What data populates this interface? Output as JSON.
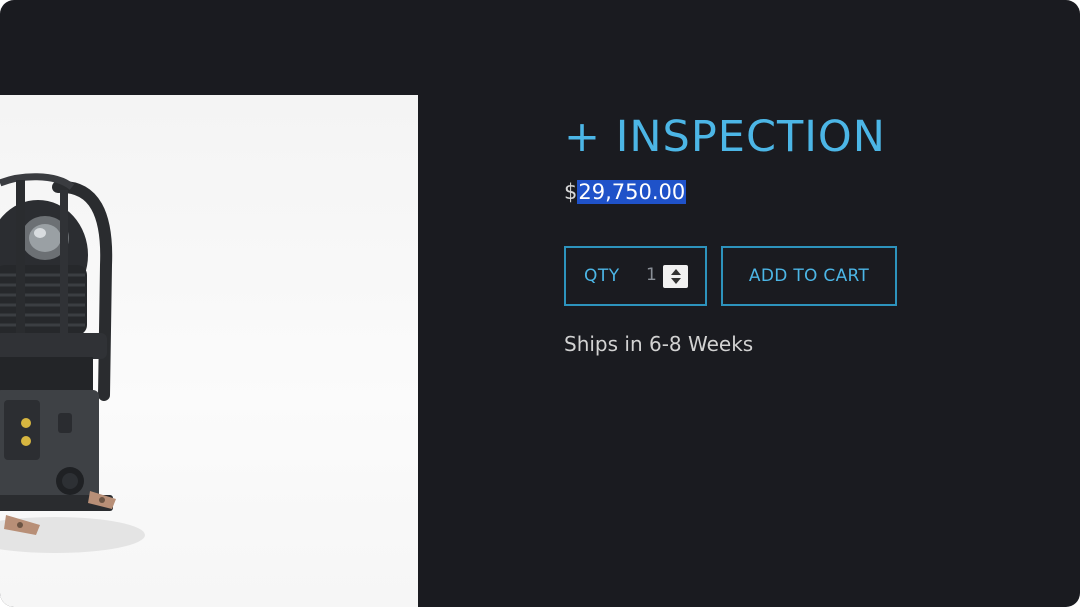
{
  "product": {
    "title": "+ INSPECTION",
    "price_currency": "$",
    "price_amount": "29,750.00",
    "shipping_note": "Ships in 6-8 Weeks"
  },
  "quantity": {
    "label": "QTY",
    "value": "1"
  },
  "cart": {
    "button_label": "ADD TO CART"
  },
  "colors": {
    "background": "#1a1b20",
    "accent": "#4cb6e6",
    "border": "#2d93bd",
    "selection": "#1f52c9"
  }
}
